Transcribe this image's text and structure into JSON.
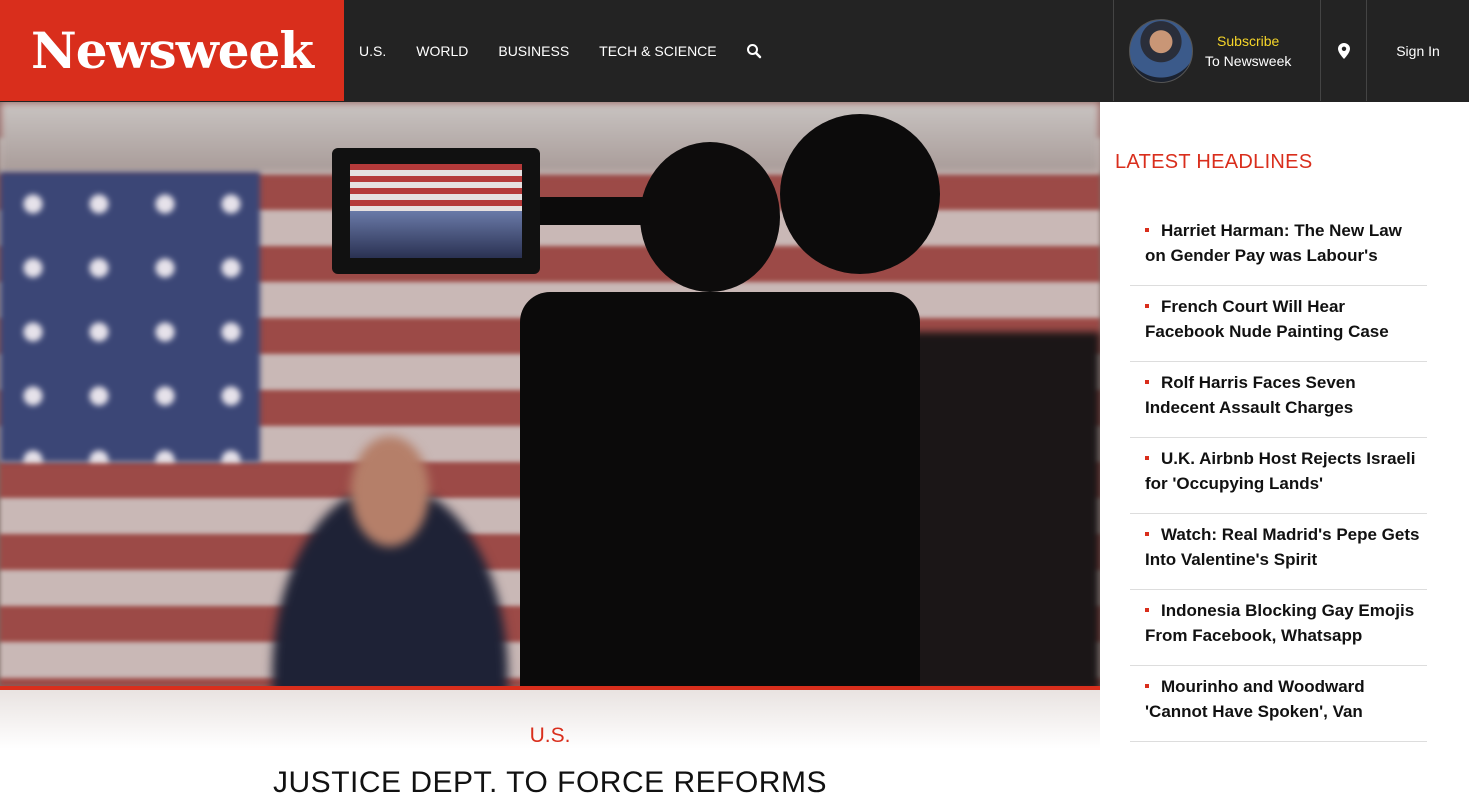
{
  "brand": {
    "logo": "Newsweek",
    "accent": "#d92e1c",
    "header_bg": "#232323"
  },
  "nav": {
    "items": [
      "U.S.",
      "WORLD",
      "BUSINESS",
      "TECH & SCIENCE"
    ],
    "search_icon": "search-icon"
  },
  "subscribe": {
    "line1": "Subscribe",
    "line2": "To Newsweek"
  },
  "location_icon": "location-pin-icon",
  "signin": "Sign In",
  "hero": {
    "category": "U.S.",
    "title": "JUSTICE DEPT. TO FORCE REFORMS"
  },
  "sidebar": {
    "title": "LATEST HEADLINES",
    "headlines": [
      "Harriet Harman: The New Law on Gender Pay was Labour's",
      "French Court Will Hear Facebook Nude Painting Case",
      "Rolf Harris Faces Seven Indecent Assault Charges",
      "U.K. Airbnb Host Rejects Israeli for 'Occupying Lands'",
      "Watch: Real Madrid's Pepe Gets Into Valentine's Spirit",
      "Indonesia Blocking Gay Emojis From Facebook, Whatsapp",
      "Mourinho and Woodward 'Cannot Have Spoken', Van"
    ]
  }
}
